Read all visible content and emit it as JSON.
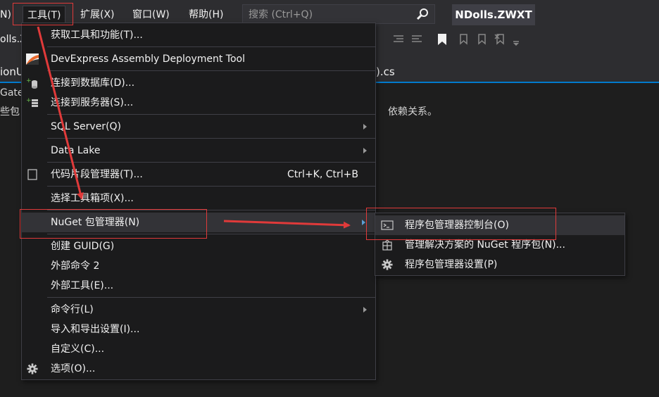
{
  "menubar": {
    "items": [
      {
        "label": "N)"
      },
      {
        "label": "工具(T)"
      },
      {
        "label": "扩展(X)"
      },
      {
        "label": "窗口(W)"
      },
      {
        "label": "帮助(H)"
      }
    ],
    "search_placeholder": "搜索 (Ctrl+Q)",
    "solution_name": "NDolls.ZWXT"
  },
  "toolbar": {
    "partial_text": "olls.Z"
  },
  "tabs": {
    "left_partial": "ionU",
    "right_partial": ").cs"
  },
  "background": {
    "line1": "Gate",
    "line2_left": "些包",
    "line2_right": "依赖关系。"
  },
  "tools_menu": {
    "items": [
      {
        "label": "获取工具和功能(T)..."
      },
      {
        "label": "DevExpress Assembly Deployment Tool"
      },
      {
        "label": "连接到数据库(D)..."
      },
      {
        "label": "连接到服务器(S)..."
      },
      {
        "label": "SQL Server(Q)"
      },
      {
        "label": "Data Lake"
      },
      {
        "label": "代码片段管理器(T)...",
        "shortcut": "Ctrl+K, Ctrl+B"
      },
      {
        "label": "选择工具箱项(X)..."
      },
      {
        "label": "NuGet 包管理器(N)"
      },
      {
        "label": "创建 GUID(G)"
      },
      {
        "label": "外部命令 2"
      },
      {
        "label": "外部工具(E)..."
      },
      {
        "label": "命令行(L)"
      },
      {
        "label": "导入和导出设置(I)..."
      },
      {
        "label": "自定义(C)..."
      },
      {
        "label": "选项(O)..."
      }
    ]
  },
  "nuget_submenu": {
    "items": [
      {
        "label": "程序包管理器控制台(O)"
      },
      {
        "label": "管理解决方案的 NuGet 程序包(N)..."
      },
      {
        "label": "程序包管理器设置(P)"
      }
    ]
  },
  "colors": {
    "background": "#1e1e1e",
    "chrome": "#2d2d30",
    "menu": "#1b1b1c",
    "highlight": "#333337",
    "accent": "#007acc",
    "annotation": "#e03a3a"
  }
}
